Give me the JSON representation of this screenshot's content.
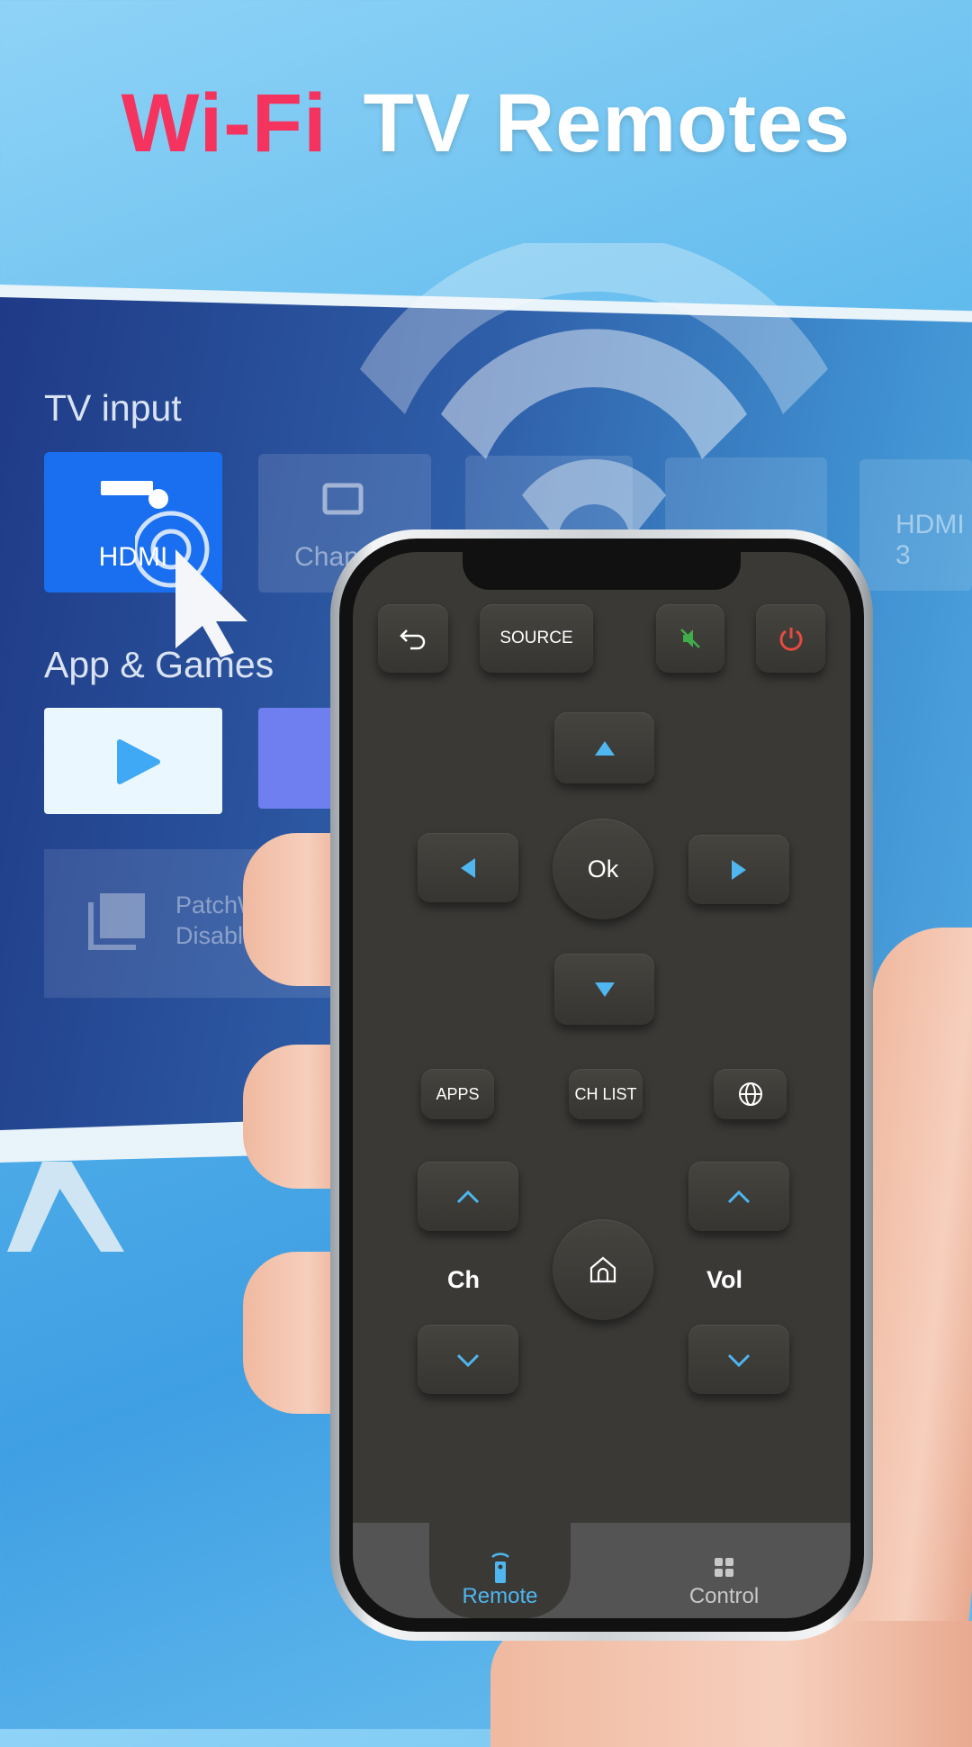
{
  "headline": {
    "part1": "Wi-Fi",
    "part2": "TV Remotes"
  },
  "tv": {
    "section1": "TV input",
    "inputs": [
      {
        "label": "HDMI",
        "icon": "hdmi-1-icon"
      },
      {
        "label": "Channel",
        "icon": "tv-icon"
      },
      {
        "label": "",
        "icon": "dots-icon"
      },
      {
        "label": "",
        "icon": "hdmi-2-icon"
      },
      {
        "label": "HDMI 3",
        "icon": "hdmi-3-icon"
      }
    ],
    "section2": "App & Games",
    "patch_title": "PatchW",
    "patch_sub": "Disable no"
  },
  "remote": {
    "back": "back-icon",
    "source": "SOURCE",
    "mute": "mute-icon",
    "power": "power-icon",
    "ok": "Ok",
    "apps": "APPS",
    "ch_list": "CH LIST",
    "globe": "globe-icon",
    "ch": "Ch",
    "vol": "Vol",
    "home": "home-icon"
  },
  "nav": {
    "tabs": [
      {
        "label": "Remote",
        "active": true
      },
      {
        "label": "Control",
        "active": false
      }
    ]
  },
  "colors": {
    "accent": "#4fb6f0",
    "headline_red": "#f5335f",
    "mute_green": "#3fae4a",
    "power_red": "#e84a3f",
    "screen_bg": "#3a3936"
  }
}
